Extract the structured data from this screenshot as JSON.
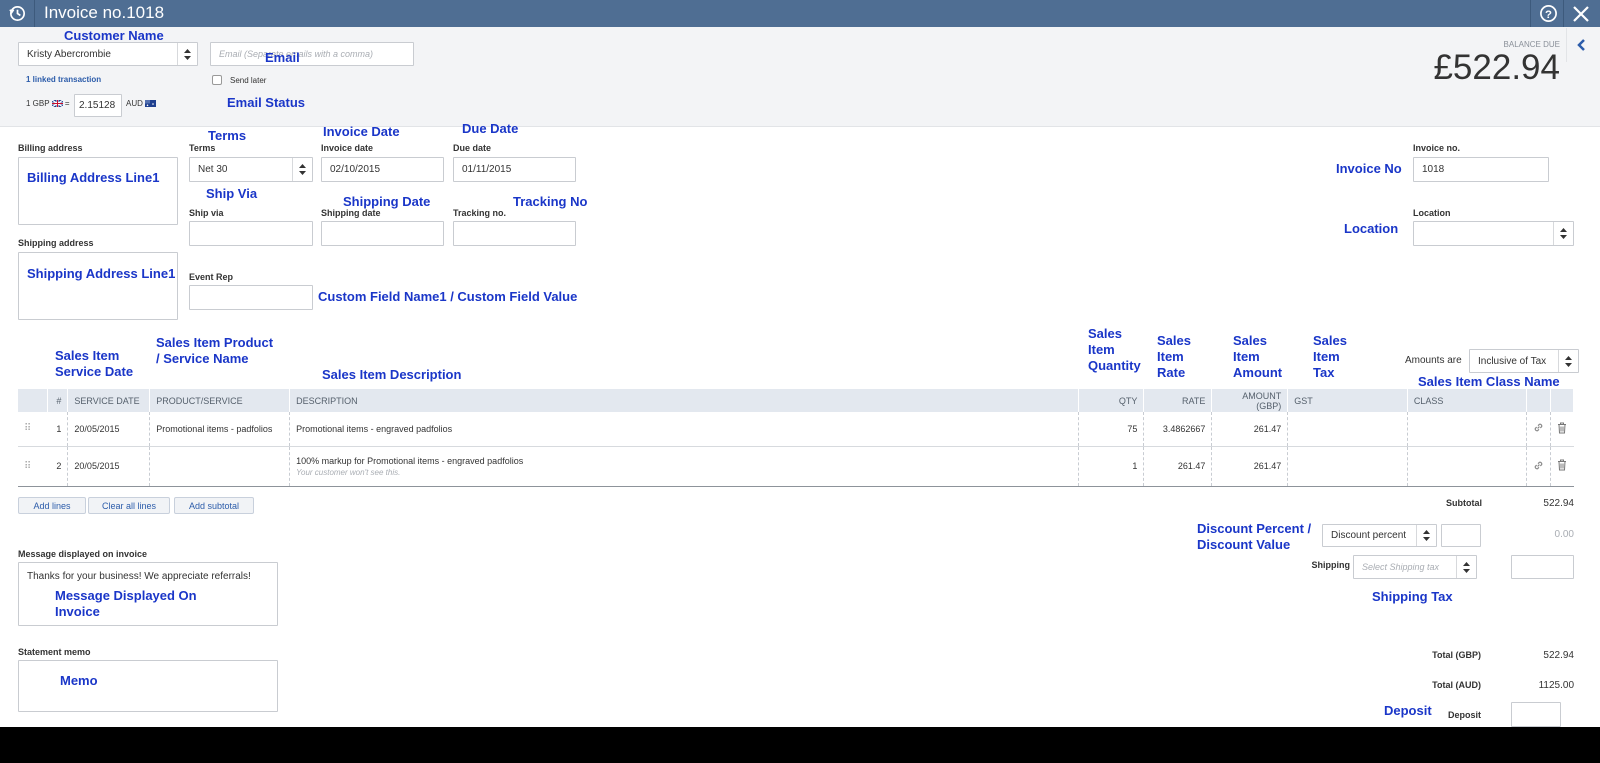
{
  "window": {
    "title": "Invoice no.1018"
  },
  "customer": {
    "name": "Kristy Abercrombie",
    "linked": "1 linked transaction"
  },
  "email": {
    "placeholder": "Email (Separate emails with a comma)",
    "send_later": "Send later"
  },
  "currency": {
    "base": "1 GBP",
    "eq": "=",
    "rate": "2.15128",
    "target": "AUD"
  },
  "balance": {
    "label": "BALANCE DUE",
    "amount": "£522.94"
  },
  "form": {
    "billing_label": "Billing address",
    "shipping_label": "Shipping address",
    "terms_label": "Terms",
    "terms_value": "Net 30",
    "invoice_date_label": "Invoice date",
    "invoice_date_value": "02/10/2015",
    "due_date_label": "Due date",
    "due_date_value": "01/11/2015",
    "ship_via_label": "Ship via",
    "shipping_date_label": "Shipping date",
    "tracking_label": "Tracking no.",
    "event_rep_label": "Event Rep",
    "invoice_no_label": "Invoice no.",
    "invoice_no_value": "1018",
    "location_label": "Location",
    "amounts_are_label": "Amounts are",
    "amounts_are_value": "Inclusive of Tax"
  },
  "table": {
    "headers": [
      "#",
      "SERVICE DATE",
      "PRODUCT/SERVICE",
      "DESCRIPTION",
      "QTY",
      "RATE",
      "AMOUNT (GBP)",
      "GST",
      "CLASS"
    ],
    "rows": [
      {
        "n": "1",
        "date": "20/05/2015",
        "product": "Promotional items - padfolios",
        "desc": "Promotional items - engraved padfolios",
        "note": "",
        "qty": "75",
        "rate": "3.4862667",
        "amount": "261.47"
      },
      {
        "n": "2",
        "date": "20/05/2015",
        "product": "",
        "desc": "100% markup for Promotional items - engraved padfolios",
        "note": "Your customer won't see this.",
        "qty": "1",
        "rate": "261.47",
        "amount": "261.47"
      }
    ]
  },
  "buttons": {
    "add_lines": "Add lines",
    "clear_all": "Clear all lines",
    "add_subtotal": "Add subtotal"
  },
  "message": {
    "label": "Message displayed on invoice",
    "value": "Thanks for your business!  We appreciate referrals!"
  },
  "memo": {
    "label": "Statement memo"
  },
  "totals": {
    "subtotal_label": "Subtotal",
    "subtotal_value": "522.94",
    "discount_type": "Discount percent",
    "discount_amount": "0.00",
    "shipping_label": "Shipping",
    "shipping_tax_placeholder": "Select Shipping tax",
    "total_gbp_label": "Total (GBP)",
    "total_gbp_value": "522.94",
    "total_aud_label": "Total (AUD)",
    "total_aud_value": "1125.00",
    "deposit_label": "Deposit"
  },
  "annotations": {
    "customer_name": "Customer Name",
    "email": "Email",
    "email_status": "Email Status",
    "terms": "Terms",
    "invoice_date": "Invoice Date",
    "due_date": "Due Date",
    "billing_address": "Billing Address Line1",
    "ship_via": "Ship Via",
    "shipping_date": "Shipping Date",
    "tracking_no": "Tracking No",
    "invoice_no": "Invoice No",
    "location": "Location",
    "shipping_address": "Shipping Address Line1",
    "custom_field": "Custom Field Name1 / Custom Field Value",
    "sales_item_service_date": "Sales Item Service Date",
    "sales_item_product": "Sales Item Product / Service Name",
    "sales_item_description": "Sales Item Description",
    "sales_item_quantity": "Sales Item Quantity",
    "sales_item_rate": "Sales Item Rate",
    "sales_item_amount": "Sales Item Amount",
    "sales_item_tax": "Sales Item Tax",
    "sales_item_class": "Sales Item Class Name",
    "discount": "Discount Percent / Discount Value",
    "message": "Message Displayed On Invoice",
    "shipping_tax": "Shipping Tax",
    "memo": "Memo",
    "deposit": "Deposit"
  },
  "colors": {
    "header": "#4f6e93",
    "annotation": "#1a36c8",
    "link": "#2c5caa"
  }
}
